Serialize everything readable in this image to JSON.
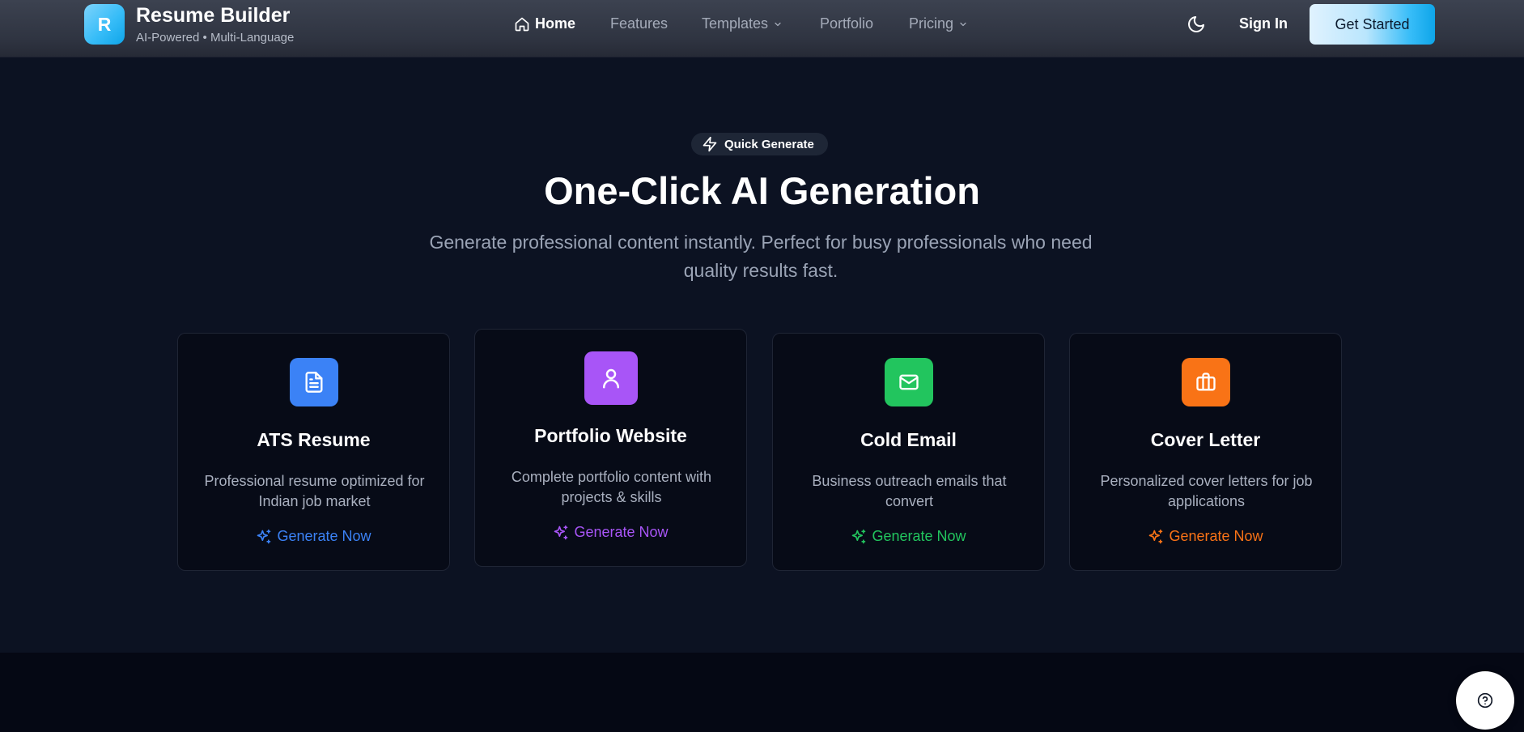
{
  "header": {
    "logo_letter": "R",
    "brand_title": "Resume Builder",
    "brand_subtitle": "AI-Powered • Multi-Language",
    "nav": {
      "home": "Home",
      "features": "Features",
      "templates": "Templates",
      "portfolio": "Portfolio",
      "pricing": "Pricing"
    },
    "sign_in": "Sign In",
    "get_started": "Get Started",
    "theme_toggle_icon": "moon-icon"
  },
  "hero": {
    "badge": "Quick Generate",
    "badge_icon": "zap-icon",
    "title": "One-Click AI Generation",
    "subtitle": "Generate professional content instantly. Perfect for busy professionals who need quality results fast."
  },
  "cards": [
    {
      "title": "ATS Resume",
      "description": "Professional resume optimized for Indian job market",
      "cta": "Generate Now",
      "icon": "file-text-icon",
      "color": "#3b82f6",
      "cta_color": "#3b82f6"
    },
    {
      "title": "Portfolio Website",
      "description": "Complete portfolio content with projects & skills",
      "cta": "Generate Now",
      "icon": "user-icon",
      "color": "#a855f7",
      "cta_color": "#a855f7"
    },
    {
      "title": "Cold Email",
      "description": "Business outreach emails that convert",
      "cta": "Generate Now",
      "icon": "mail-icon",
      "color": "#22c55e",
      "cta_color": "#22c55e"
    },
    {
      "title": "Cover Letter",
      "description": "Personalized cover letters for job applications",
      "cta": "Generate Now",
      "icon": "briefcase-icon",
      "color": "#f97316",
      "cta_color": "#f97316"
    }
  ],
  "help_icon": "help-circle-icon"
}
